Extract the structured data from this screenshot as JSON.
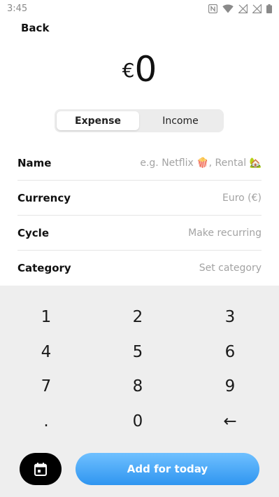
{
  "status_bar": {
    "time": "3:45"
  },
  "nav": {
    "back_label": "Back"
  },
  "amount": {
    "currency_symbol": "€",
    "value": "0"
  },
  "type_toggle": {
    "options": [
      "Expense",
      "Income"
    ],
    "selected": "Expense"
  },
  "form": {
    "rows": [
      {
        "label": "Name",
        "placeholder": "e.g. Netflix 🍿, Rental 🏡"
      },
      {
        "label": "Currency",
        "placeholder": "Euro (€)"
      },
      {
        "label": "Cycle",
        "placeholder": "Make recurring"
      },
      {
        "label": "Category",
        "placeholder": "Set category"
      }
    ]
  },
  "keypad": {
    "keys": [
      "1",
      "2",
      "3",
      "4",
      "5",
      "6",
      "7",
      "8",
      "9",
      ".",
      "0",
      "←"
    ]
  },
  "actions": {
    "calendar_icon": "calendar-icon",
    "add_label": "Add for today"
  },
  "colors": {
    "accent_gradient_top": "#6fc0ff",
    "accent_gradient_bottom": "#2f95f0",
    "keypad_bg": "#eeeeee",
    "placeholder": "#a3a3a3"
  }
}
